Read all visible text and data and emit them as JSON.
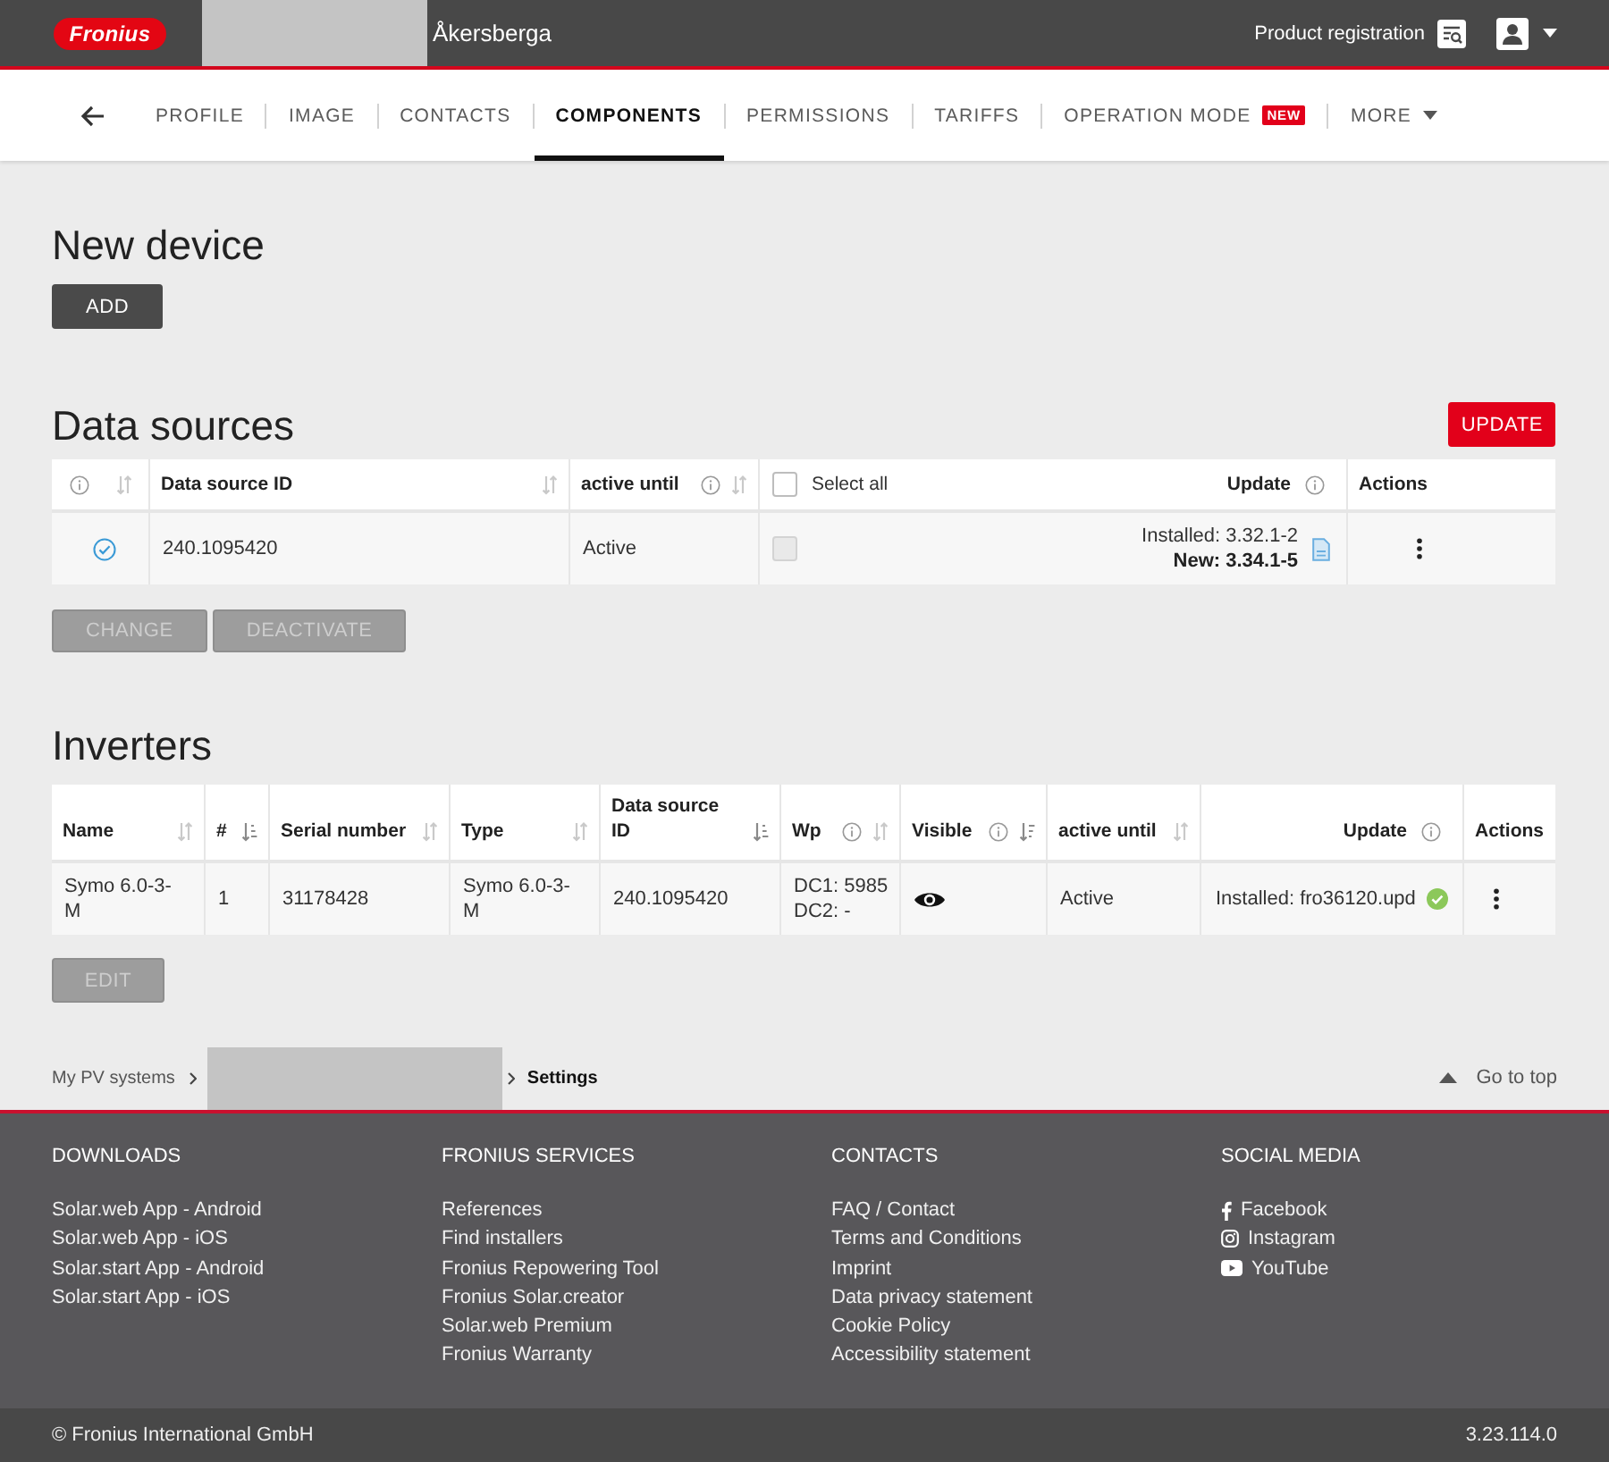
{
  "header": {
    "logo": "Fronius",
    "site_name": "Åkersberga",
    "product_registration": "Product registration"
  },
  "nav": {
    "tabs": [
      {
        "label": "PROFILE",
        "selected": false
      },
      {
        "label": "IMAGE",
        "selected": false
      },
      {
        "label": "CONTACTS",
        "selected": false
      },
      {
        "label": "COMPONENTS",
        "selected": true
      },
      {
        "label": "PERMISSIONS",
        "selected": false
      },
      {
        "label": "TARIFFS",
        "selected": false
      },
      {
        "label": "OPERATION MODE",
        "selected": false,
        "badge": "NEW"
      },
      {
        "label": "MORE",
        "selected": false,
        "dropdown": true
      }
    ]
  },
  "new_device": {
    "title": "New device",
    "button": "ADD"
  },
  "data_sources": {
    "title": "Data sources",
    "update_button": "UPDATE",
    "columns": [
      {
        "kind": "status",
        "info": true,
        "sortable": true,
        "sorted": false
      },
      {
        "kind": "text",
        "label": "Data source ID",
        "sortable": true,
        "sorted": false
      },
      {
        "kind": "text",
        "label": "active until",
        "info": true,
        "sortable": true,
        "sorted": false
      },
      {
        "kind": "select",
        "label": "Select all",
        "checked": false
      },
      {
        "kind": "update",
        "label": "Update",
        "info": true
      },
      {
        "kind": "actions",
        "label": "Actions"
      }
    ],
    "rows": [
      {
        "connected": true,
        "id": "240.1095420",
        "active_until": "Active",
        "checked": false,
        "disabled": true,
        "update_installed": "Installed: 3.32.1-2",
        "update_new": "New: 3.34.1-5"
      }
    ],
    "buttons": [
      {
        "label": "CHANGE",
        "disabled": true
      },
      {
        "label": "DEACTIVATE",
        "disabled": true
      }
    ]
  },
  "inverters": {
    "title": "Inverters",
    "columns": [
      {
        "kind": "text",
        "label": "Name",
        "sortable": true,
        "sorted": false
      },
      {
        "kind": "text",
        "label": "#",
        "sortable": true,
        "sorted": true,
        "descending": false
      },
      {
        "kind": "text",
        "label": "Serial number",
        "sortable": true,
        "sorted": false
      },
      {
        "kind": "text",
        "label": "Type",
        "sortable": true,
        "sorted": false
      },
      {
        "kind": "text",
        "label": "Data source ID",
        "sortable": true,
        "sorted": true,
        "descending": false
      },
      {
        "kind": "text",
        "label": "Wp",
        "info": true,
        "sortable": true,
        "sorted": false
      },
      {
        "kind": "text",
        "label": "Visible",
        "info": true,
        "sortable": true,
        "sorted": true,
        "descending": true
      },
      {
        "kind": "text",
        "label": "active until",
        "sortable": true,
        "sorted": false
      },
      {
        "kind": "update",
        "label": "Update",
        "info": true
      },
      {
        "kind": "actions",
        "label": "Actions"
      }
    ],
    "rows": [
      {
        "name": "Symo 6.0-3-M",
        "number": "1",
        "serial": "31178428",
        "type": "Symo 6.0-3-M",
        "data_source_id": "240.1095420",
        "wp": [
          "DC1: 5985",
          "DC2: -"
        ],
        "visible": true,
        "active_until": "Active",
        "update": "Installed: fro36120.upd",
        "update_ok": true
      }
    ],
    "buttons": [
      {
        "label": "EDIT",
        "disabled": true
      }
    ]
  },
  "breadcrumb": {
    "root": "My PV systems",
    "current": "Settings",
    "go_to_top": "Go to top"
  },
  "footer": {
    "columns": [
      {
        "title": "DOWNLOADS",
        "links": [
          "Solar.web App - Android",
          "Solar.web App - iOS",
          "Solar.start App - Android",
          "Solar.start App - iOS"
        ]
      },
      {
        "title": "FRONIUS SERVICES",
        "links": [
          "References",
          "Find installers",
          "Fronius Repowering Tool",
          "Fronius Solar.creator",
          "Solar.web Premium",
          "Fronius Warranty"
        ]
      },
      {
        "title": "CONTACTS",
        "links": [
          "FAQ / Contact",
          "Terms and Conditions",
          "Imprint",
          "Data privacy statement",
          "Cookie Policy",
          "Accessibility statement"
        ]
      }
    ],
    "social": {
      "title": "SOCIAL MEDIA",
      "links": [
        {
          "label": "Facebook",
          "kind": "facebook"
        },
        {
          "label": "Instagram",
          "kind": "instagram"
        },
        {
          "label": "YouTube",
          "kind": "youtube"
        }
      ]
    },
    "copyright": "© Fronius International GmbH",
    "version": "3.23.114.0"
  }
}
